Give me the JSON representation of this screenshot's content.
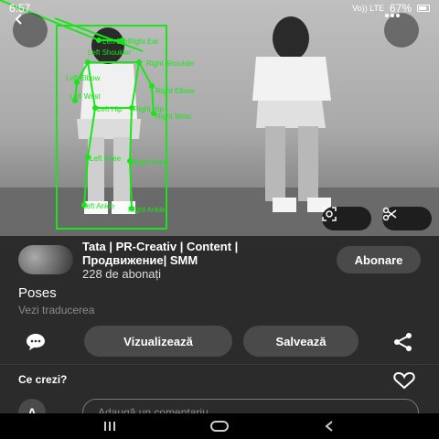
{
  "status_bar": {
    "time": "6:57",
    "net_label": "Vo)) LTE",
    "battery": "67%"
  },
  "image": {
    "description_icons": [
      "back-arrow-icon",
      "more-dots-icon",
      "visual-search-icon",
      "scissors-icon"
    ],
    "pose_labels": {
      "left_ear": "Left Ear",
      "right_ear": "Right Ear",
      "left_shoulder": "Left Shoulder",
      "right_shoulder": "Right Shoulder",
      "left_elbow": "Left Elbow",
      "right_elbow": "Right Elbow",
      "left_wrist": "Left Wrist",
      "right_wrist": "Right Wrist",
      "left_hip": "Left Hip",
      "right_hip": "Right Hip",
      "left_knee": "Left Knee",
      "right_knee": "Right Knee",
      "left_ankle": "Left Ankle",
      "right_ankle": "Right Ankle"
    },
    "pose_color": "#19e619"
  },
  "creator": {
    "name_line1": "Tata | PR-Creativ | Content |",
    "name_line2": "Продвижение| SMM",
    "followers": "228 de abonați",
    "follow_label": "Abonare"
  },
  "pin": {
    "title": "Poses",
    "translate_label": "Vezi traducerea"
  },
  "actions": {
    "visit_label": "Vizualizează",
    "save_label": "Salvează"
  },
  "comments": {
    "heading": "Ce crezi?",
    "avatar_initial": "A",
    "placeholder": "Adaugă un comentariu"
  }
}
